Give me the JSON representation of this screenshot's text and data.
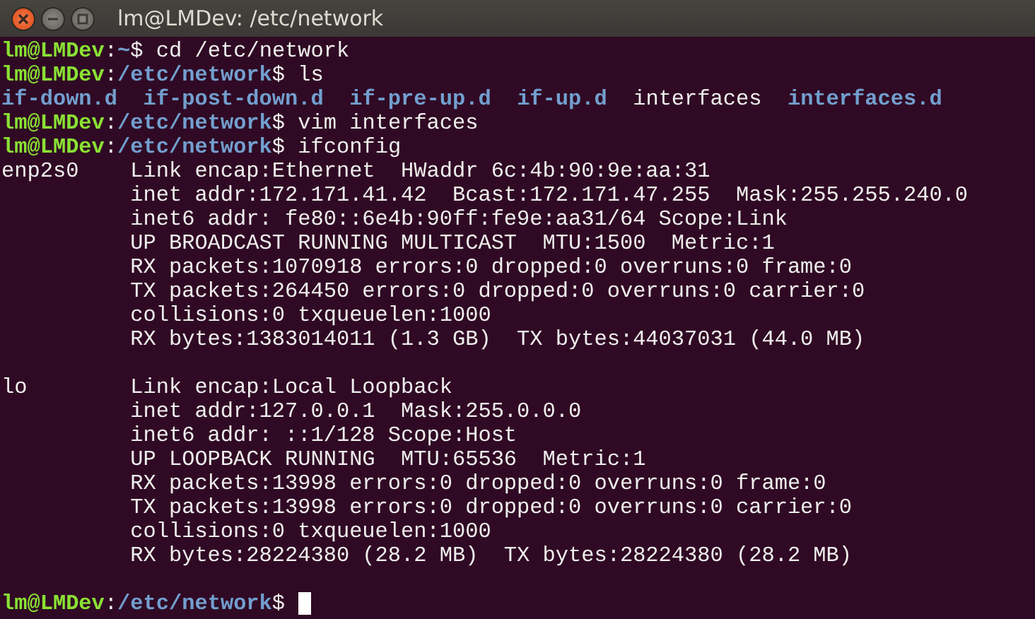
{
  "window": {
    "title": "lm@LMDev: /etc/network",
    "controls": [
      {
        "kind": "close"
      },
      {
        "kind": "minimize"
      },
      {
        "kind": "maximize"
      }
    ]
  },
  "terminal": {
    "lines": [
      {
        "kind": "prompt",
        "user": "lm@LMDev",
        "sep": ":",
        "path": "~",
        "dollar": "$",
        "command": "cd /etc/network"
      },
      {
        "kind": "prompt",
        "user": "lm@LMDev",
        "sep": ":",
        "path": "/etc/network",
        "dollar": "$",
        "command": "ls"
      },
      {
        "kind": "listing",
        "entries": [
          {
            "name": "if-down.d",
            "directory": true
          },
          {
            "name": "if-post-down.d",
            "directory": true
          },
          {
            "name": "if-pre-up.d",
            "directory": true
          },
          {
            "name": "if-up.d",
            "directory": true
          },
          {
            "name": "interfaces",
            "directory": false
          },
          {
            "name": "interfaces.d",
            "directory": true
          }
        ]
      },
      {
        "kind": "prompt",
        "user": "lm@LMDev",
        "sep": ":",
        "path": "/etc/network",
        "dollar": "$",
        "command": "vim interfaces"
      },
      {
        "kind": "prompt",
        "user": "lm@LMDev",
        "sep": ":",
        "path": "/etc/network",
        "dollar": "$",
        "command": "ifconfig"
      },
      {
        "kind": "output",
        "iface": "enp2s0",
        "text": "Link encap:Ethernet  HWaddr 6c:4b:90:9e:aa:31"
      },
      {
        "kind": "output",
        "text": "inet addr:172.171.41.42  Bcast:172.171.47.255  Mask:255.255.240.0"
      },
      {
        "kind": "output",
        "text": "inet6 addr: fe80::6e4b:90ff:fe9e:aa31/64 Scope:Link"
      },
      {
        "kind": "output",
        "text": "UP BROADCAST RUNNING MULTICAST  MTU:1500  Metric:1"
      },
      {
        "kind": "output",
        "text": "RX packets:1070918 errors:0 dropped:0 overruns:0 frame:0"
      },
      {
        "kind": "output",
        "text": "TX packets:264450 errors:0 dropped:0 overruns:0 carrier:0"
      },
      {
        "kind": "output",
        "text": "collisions:0 txqueuelen:1000"
      },
      {
        "kind": "output",
        "text": "RX bytes:1383014011 (1.3 GB)  TX bytes:44037031 (44.0 MB)"
      },
      {
        "kind": "blank"
      },
      {
        "kind": "output",
        "iface": "lo",
        "text": "Link encap:Local Loopback"
      },
      {
        "kind": "output",
        "text": "inet addr:127.0.0.1  Mask:255.0.0.0"
      },
      {
        "kind": "output",
        "text": "inet6 addr: ::1/128 Scope:Host"
      },
      {
        "kind": "output",
        "text": "UP LOOPBACK RUNNING  MTU:65536  Metric:1"
      },
      {
        "kind": "output",
        "text": "RX packets:13998 errors:0 dropped:0 overruns:0 frame:0"
      },
      {
        "kind": "output",
        "text": "TX packets:13998 errors:0 dropped:0 overruns:0 carrier:0"
      },
      {
        "kind": "output",
        "text": "collisions:0 txqueuelen:1000"
      },
      {
        "kind": "output",
        "text": "RX bytes:28224380 (28.2 MB)  TX bytes:28224380 (28.2 MB)"
      },
      {
        "kind": "blank"
      },
      {
        "kind": "prompt",
        "user": "lm@LMDev",
        "sep": ":",
        "path": "/etc/network",
        "dollar": "$",
        "cursor": true
      }
    ]
  }
}
